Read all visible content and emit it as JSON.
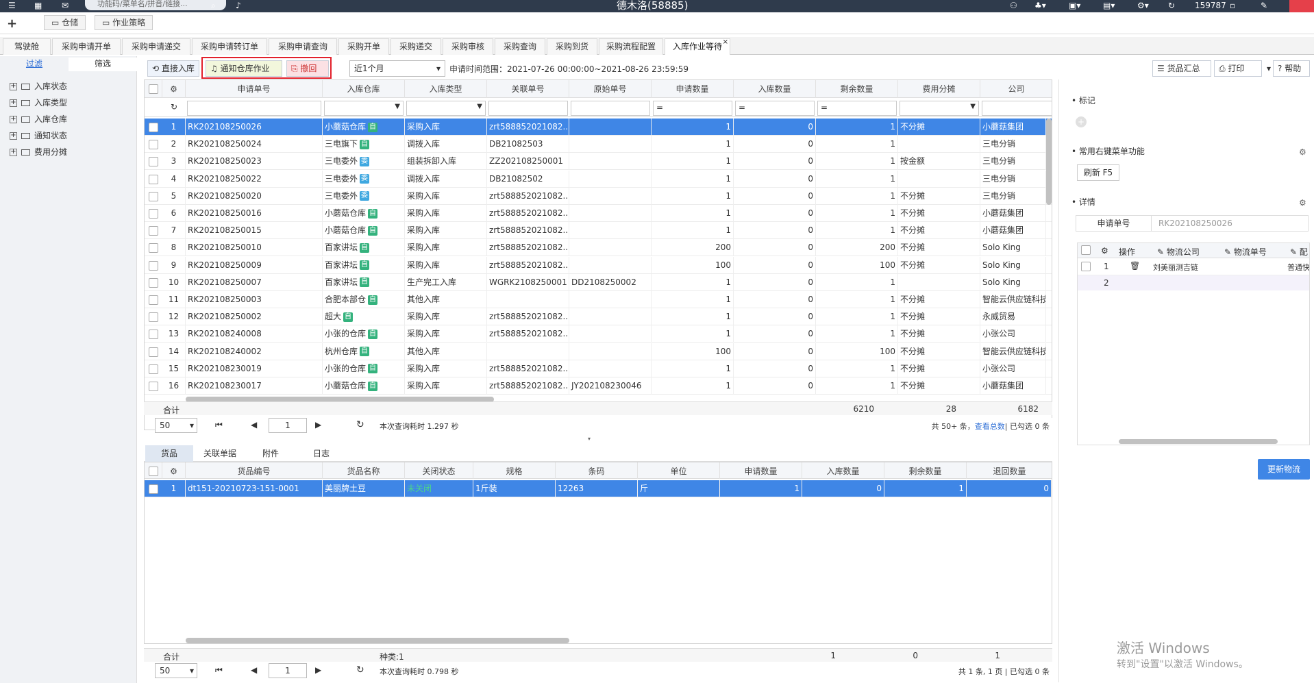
{
  "topbar": {
    "search_placeholder": "功能码/菜单名/拼音/链接...",
    "title": "德木洛(58885)",
    "user": "159787"
  },
  "quickbar": {
    "plus": "+",
    "folders": [
      "仓储",
      "作业策略"
    ]
  },
  "tabs": [
    "驾驶舱",
    "采购申请开单",
    "采购申请递交",
    "采购申请转订单",
    "采购申请查询",
    "采购开单",
    "采购递交",
    "采购审核",
    "采购查询",
    "采购到货",
    "采购流程配置",
    "入库作业等待"
  ],
  "left": {
    "tabs": [
      "过滤",
      "筛选"
    ],
    "tree": [
      "入库状态",
      "入库类型",
      "入库仓库",
      "通知状态",
      "费用分摊"
    ]
  },
  "toolbar": {
    "direct": "直接入库",
    "notify": "通知仓库作业",
    "revoke": "撤回",
    "period": "近1个月",
    "range_label": "申请时间范围：",
    "range": "2021-07-26 00:00:00~2021-08-26 23:59:59",
    "summary_btn": "货品汇总",
    "print_btn": "打印",
    "help_btn": "帮助"
  },
  "grid": {
    "columns": [
      "申请单号",
      "入库仓库",
      "入库类型",
      "关联单号",
      "原始单号",
      "申请数量",
      "入库数量",
      "剩余数量",
      "费用分摊",
      "公司"
    ],
    "filter_ops": [
      "=",
      "=",
      "="
    ],
    "rows": [
      [
        "1",
        "RK202108250026",
        "小蘑菇仓库",
        "自",
        "采购入库",
        "zrt588852021082...",
        "",
        "1",
        "0",
        "1",
        "不分摊",
        "小蘑菇集团"
      ],
      [
        "2",
        "RK202108250024",
        "三电旗下",
        "自",
        "调拨入库",
        "DB21082503",
        "",
        "1",
        "0",
        "1",
        "",
        "三电分销"
      ],
      [
        "3",
        "RK202108250023",
        "三电委外",
        "委",
        "组装拆卸入库",
        "ZZ202108250001",
        "",
        "1",
        "0",
        "1",
        "按金额",
        "三电分销"
      ],
      [
        "4",
        "RK202108250022",
        "三电委外",
        "委",
        "调拨入库",
        "DB21082502",
        "",
        "1",
        "0",
        "1",
        "",
        "三电分销"
      ],
      [
        "5",
        "RK202108250020",
        "三电委外",
        "委",
        "采购入库",
        "zrt588852021082...",
        "",
        "1",
        "0",
        "1",
        "不分摊",
        "三电分销"
      ],
      [
        "6",
        "RK202108250016",
        "小蘑菇仓库",
        "自",
        "采购入库",
        "zrt588852021082...",
        "",
        "1",
        "0",
        "1",
        "不分摊",
        "小蘑菇集团"
      ],
      [
        "7",
        "RK202108250015",
        "小蘑菇仓库",
        "自",
        "采购入库",
        "zrt588852021082...",
        "",
        "1",
        "0",
        "1",
        "不分摊",
        "小蘑菇集团"
      ],
      [
        "8",
        "RK202108250010",
        "百家讲坛",
        "自",
        "采购入库",
        "zrt588852021082...",
        "",
        "200",
        "0",
        "200",
        "不分摊",
        "Solo King"
      ],
      [
        "9",
        "RK202108250009",
        "百家讲坛",
        "自",
        "采购入库",
        "zrt588852021082...",
        "",
        "100",
        "0",
        "100",
        "不分摊",
        "Solo King"
      ],
      [
        "10",
        "RK202108250007",
        "百家讲坛",
        "自",
        "生产完工入库",
        "WGRK2108250001",
        "DD2108250002",
        "1",
        "0",
        "1",
        "",
        "Solo King"
      ],
      [
        "11",
        "RK202108250003",
        "合肥本部仓",
        "自",
        "其他入库",
        "",
        "",
        "1",
        "0",
        "1",
        "不分摊",
        "智能云供应链科技"
      ],
      [
        "12",
        "RK202108250002",
        "超大",
        "自",
        "采购入库",
        "zrt588852021082...",
        "",
        "1",
        "0",
        "1",
        "不分摊",
        "永威贸易"
      ],
      [
        "13",
        "RK202108240008",
        "小张的仓库",
        "自",
        "采购入库",
        "zrt588852021082...",
        "",
        "1",
        "0",
        "1",
        "不分摊",
        "小张公司"
      ],
      [
        "14",
        "RK202108240002",
        "杭州仓库",
        "自",
        "其他入库",
        "",
        "",
        "100",
        "0",
        "100",
        "不分摊",
        "智能云供应链科技"
      ],
      [
        "15",
        "RK202108230019",
        "小张的仓库",
        "自",
        "采购入库",
        "zrt588852021082...",
        "",
        "1",
        "0",
        "1",
        "不分摊",
        "小张公司"
      ],
      [
        "16",
        "RK202108230017",
        "小蘑菇仓库",
        "自",
        "采购入库",
        "zrt588852021082...",
        "JY202108230046",
        "1",
        "0",
        "1",
        "不分摊",
        "小蘑菇集团"
      ]
    ],
    "sum_label": "合计",
    "sum_apply": "6210",
    "sum_in": "28",
    "sum_remain": "6182"
  },
  "pager1": {
    "size": "50",
    "page": "1",
    "time": "本次查询耗时 1.297 秒",
    "total_prefix": "共 50+ 条，",
    "total_link": "查看总数",
    "total_suffix": "| 已勾选 0 条"
  },
  "subtabs": [
    "货品",
    "关联单据",
    "附件",
    "日志"
  ],
  "grid2": {
    "columns": [
      "货品编号",
      "货品名称",
      "关闭状态",
      "规格",
      "条码",
      "单位",
      "申请数量",
      "入库数量",
      "剩余数量",
      "退回数量"
    ],
    "rows": [
      [
        "1",
        "dt151-20210723-151-0001",
        "美丽牌土豆",
        "未关闭",
        "1斤装",
        "12263",
        "斤",
        "1",
        "0",
        "1",
        "0"
      ]
    ],
    "sum_label": "合计",
    "kinds": "种类:1",
    "sum_apply": "1",
    "sum_in": "0",
    "sum_remain": "1"
  },
  "pager2": {
    "size": "50",
    "page": "1",
    "time": "本次查询耗时 0.798 秒",
    "total": "共 1 条, 1 页 | 已勾选 0 条"
  },
  "right": {
    "mark": "标记",
    "common": "常用右键菜单功能",
    "refresh": "刷新  F5",
    "detail": "详情",
    "apply_label": "申请单号",
    "apply_value": "RK202108250026",
    "log_cols": [
      "操作",
      "物流公司",
      "物流单号",
      "配"
    ],
    "log_rows": [
      [
        "1",
        "刘美丽测吉链",
        "",
        "普通快"
      ],
      [
        "2",
        "",
        "",
        ""
      ]
    ],
    "update_btn": "更新物流"
  },
  "watermark": {
    "line1": "激活 Windows",
    "line2": "转到\"设置\"以激活 Windows。"
  }
}
